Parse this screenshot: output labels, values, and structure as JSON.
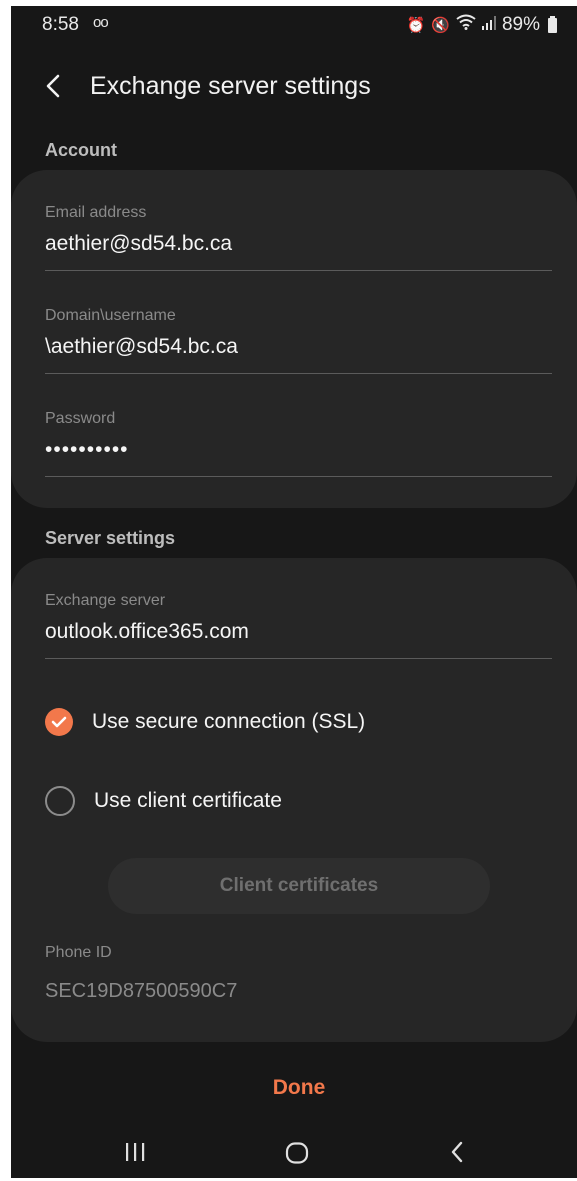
{
  "status_bar": {
    "time": "8:58",
    "voicemail_icon": "oo",
    "battery": "89%",
    "icons": [
      "alarm-icon",
      "mute-icon",
      "wifi-icon",
      "signal-icon",
      "battery-icon"
    ]
  },
  "header": {
    "title": "Exchange server settings",
    "back_icon": "chevron-left-icon"
  },
  "account": {
    "section_label": "Account",
    "email_label": "Email address",
    "email_value": "aethier@sd54.bc.ca",
    "domain_label": "Domain\\username",
    "domain_value": "\\aethier@sd54.bc.ca",
    "password_label": "Password",
    "password_value": "••••••••••"
  },
  "server": {
    "section_label": "Server settings",
    "exchange_label": "Exchange server",
    "exchange_value": "outlook.office365.com",
    "ssl_label": "Use secure connection (SSL)",
    "ssl_checked": true,
    "client_cert_label": "Use client certificate",
    "client_cert_checked": false,
    "client_certificates_button": "Client certificates",
    "phone_id_label": "Phone ID",
    "phone_id_value": "SEC19D87500590C7"
  },
  "footer": {
    "done_label": "Done"
  },
  "colors": {
    "background": "#171717",
    "card": "#262626",
    "accent": "#f2784b"
  }
}
